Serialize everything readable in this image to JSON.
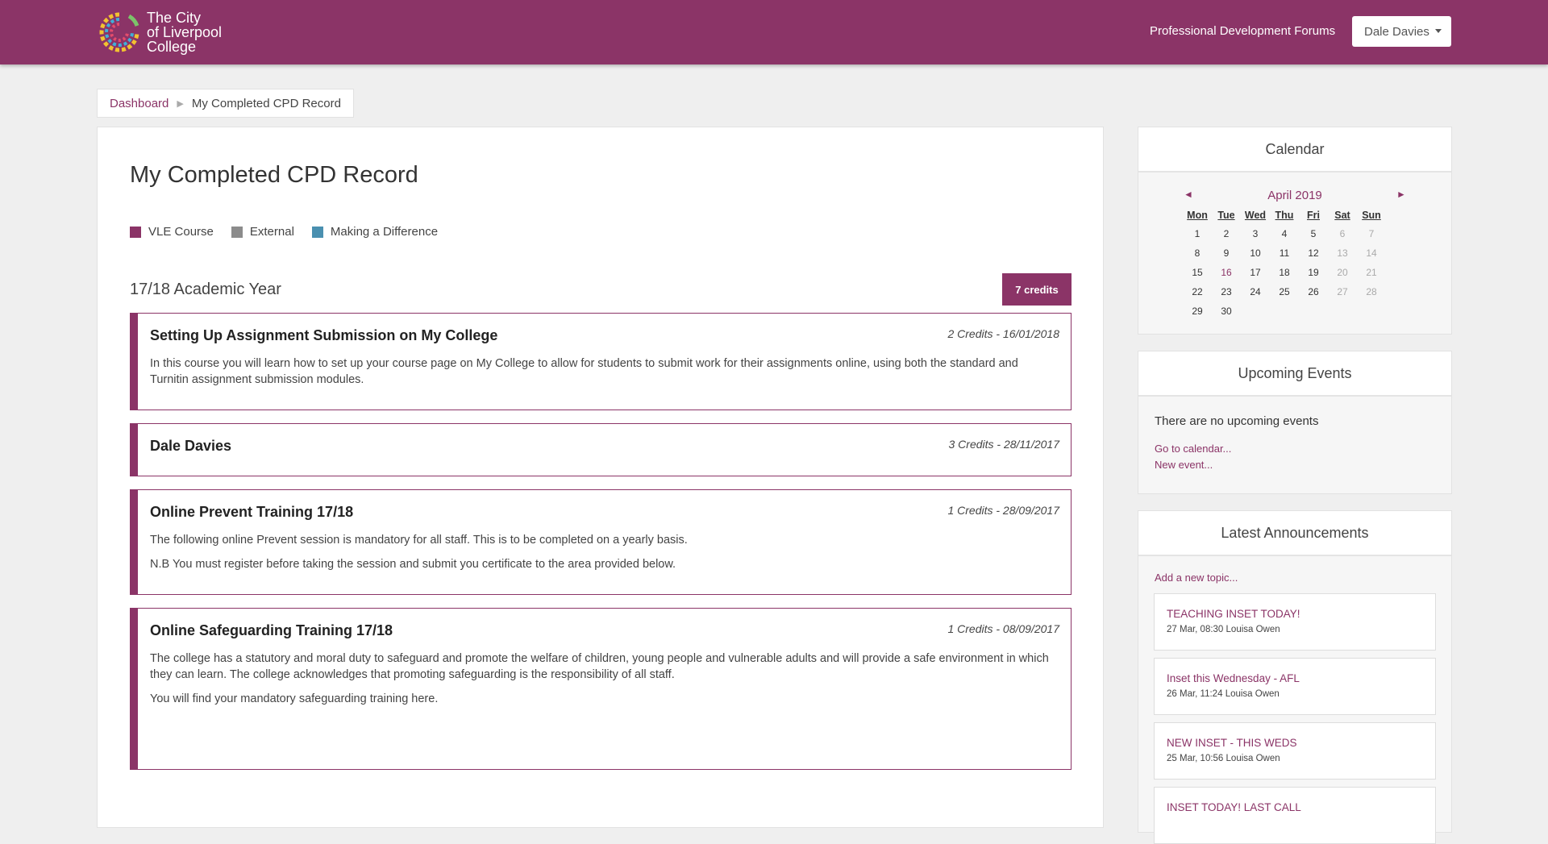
{
  "header": {
    "logo_lines": [
      "The City",
      "of Liverpool",
      "College"
    ],
    "forums_link": "Professional Development Forums",
    "user_name": "Dale Davies"
  },
  "breadcrumb": {
    "home": "Dashboard",
    "current": "My Completed CPD Record"
  },
  "main": {
    "title": "My Completed CPD Record",
    "legend": [
      {
        "label": "VLE Course",
        "color": "#8b3467"
      },
      {
        "label": "External",
        "color": "#8c8c8c"
      },
      {
        "label": "Making a Difference",
        "color": "#4a90b0"
      }
    ],
    "year_title": "17/18 Academic Year",
    "year_credits": "7 credits",
    "courses": [
      {
        "title": "Setting Up Assignment Submission on My College",
        "meta": "2 Credits - 16/01/2018",
        "paragraphs": [
          "In this course you will learn how to set up your course page on My College to allow for students to submit work for their assignments online, using both the standard and Turnitin assignment submission modules."
        ]
      },
      {
        "title": "Dale Davies",
        "meta": "3 Credits - 28/11/2017",
        "paragraphs": []
      },
      {
        "title": "Online Prevent Training 17/18",
        "meta": "1 Credits - 28/09/2017",
        "paragraphs": [
          "The following online Prevent session is mandatory for all staff. This is to be completed on a yearly basis.",
          "N.B You must register before taking the session and submit you certificate to the area provided below."
        ]
      },
      {
        "title": "Online Safeguarding Training 17/18",
        "meta": "1 Credits - 08/09/2017",
        "paragraphs": [
          "The college has a statutory and moral duty to safeguard and promote the welfare of children, young people and vulnerable adults and will provide a safe environment in which they can learn. The college acknowledges that promoting safeguarding is the responsibility of all staff.",
          "You will find your mandatory safeguarding training here."
        ]
      }
    ]
  },
  "calendar": {
    "title": "Calendar",
    "month": "April 2019",
    "prev": "◄",
    "next": "►",
    "weekdays": [
      "Mon",
      "Tue",
      "Wed",
      "Thu",
      "Fri",
      "Sat",
      "Sun"
    ],
    "weeks": [
      [
        "1",
        "2",
        "3",
        "4",
        "5",
        "6",
        "7"
      ],
      [
        "8",
        "9",
        "10",
        "11",
        "12",
        "13",
        "14"
      ],
      [
        "15",
        "16",
        "17",
        "18",
        "19",
        "20",
        "21"
      ],
      [
        "22",
        "23",
        "24",
        "25",
        "26",
        "27",
        "28"
      ],
      [
        "29",
        "30",
        "",
        "",
        "",
        "",
        ""
      ]
    ],
    "highlighted_day": "16"
  },
  "upcoming": {
    "title": "Upcoming Events",
    "empty_text": "There are no upcoming events",
    "go_calendar": "Go to calendar...",
    "new_event": "New event..."
  },
  "announcements": {
    "title": "Latest Announcements",
    "add_topic": "Add a new topic...",
    "items": [
      {
        "title": "TEACHING INSET TODAY!",
        "date": "27 Mar, 08:30",
        "author": "Louisa Owen"
      },
      {
        "title": "Inset this Wednesday - AFL",
        "date": "26 Mar, 11:24",
        "author": "Louisa Owen"
      },
      {
        "title": "NEW INSET - THIS WEDS",
        "date": "25 Mar, 10:56",
        "author": "Louisa Owen"
      },
      {
        "title": "INSET TODAY! LAST CALL",
        "date": "",
        "author": ""
      }
    ]
  }
}
